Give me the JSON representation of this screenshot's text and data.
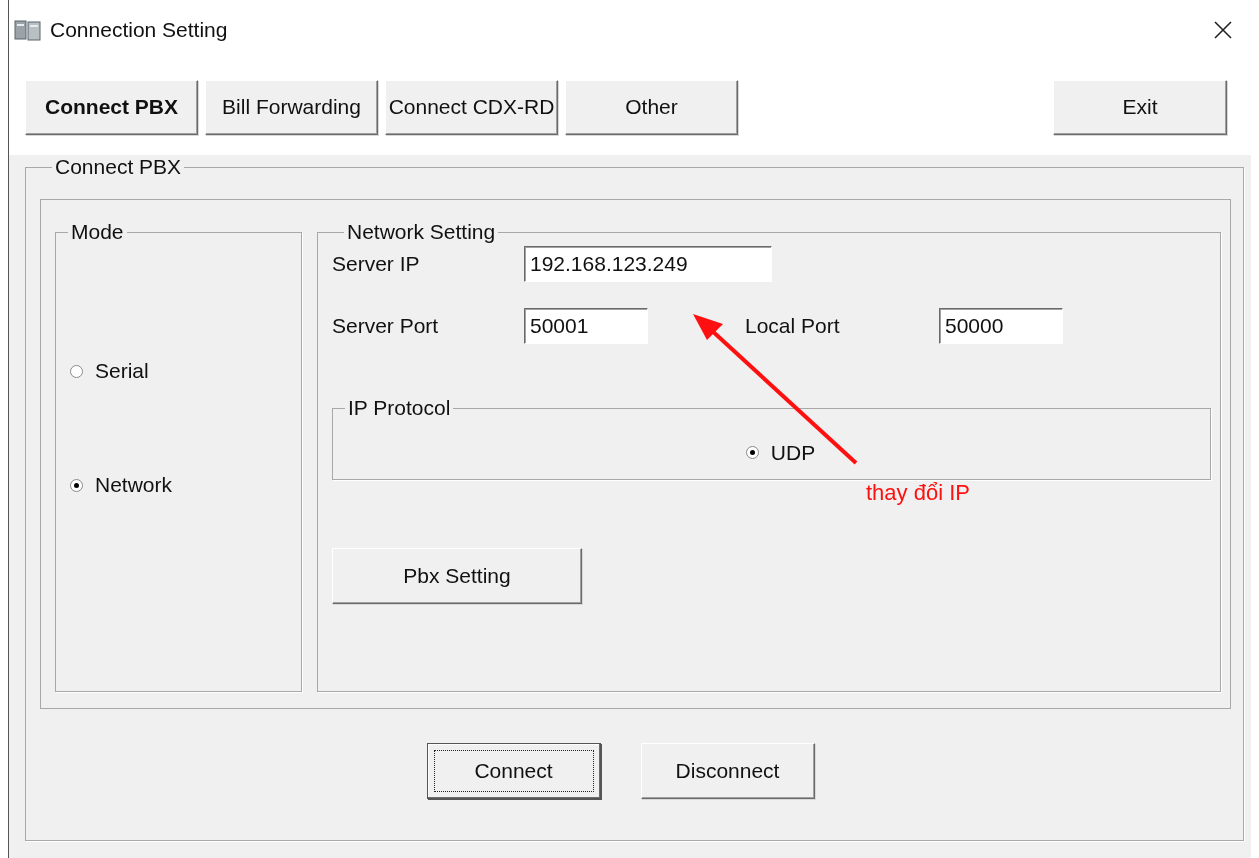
{
  "window": {
    "title": "Connection Setting"
  },
  "tabs": [
    {
      "label": "Connect PBX",
      "selected": true
    },
    {
      "label": "Bill Forwarding",
      "selected": false
    },
    {
      "label": "Connect CDX-RD",
      "selected": false
    },
    {
      "label": "Other",
      "selected": false
    }
  ],
  "exit_button": "Exit",
  "main_group": {
    "title": "Connect PBX"
  },
  "mode": {
    "title": "Mode",
    "options": [
      {
        "label": "Serial",
        "selected": false
      },
      {
        "label": "Network",
        "selected": true
      }
    ]
  },
  "network": {
    "title": "Network Setting",
    "server_ip": {
      "label": "Server IP",
      "value": "192.168.123.249"
    },
    "server_port": {
      "label": "Server Port",
      "value": "50001"
    },
    "local_port": {
      "label": "Local Port",
      "value": "50000"
    },
    "protocol": {
      "title": "IP Protocol",
      "options": [
        {
          "label": "UDP",
          "selected": true
        }
      ]
    },
    "pbx_button": "Pbx Setting"
  },
  "buttons": [
    {
      "label": "Connect",
      "focused": true
    },
    {
      "label": "Disconnect",
      "focused": false
    }
  ],
  "annotation": {
    "text": "thay đổi IP"
  }
}
